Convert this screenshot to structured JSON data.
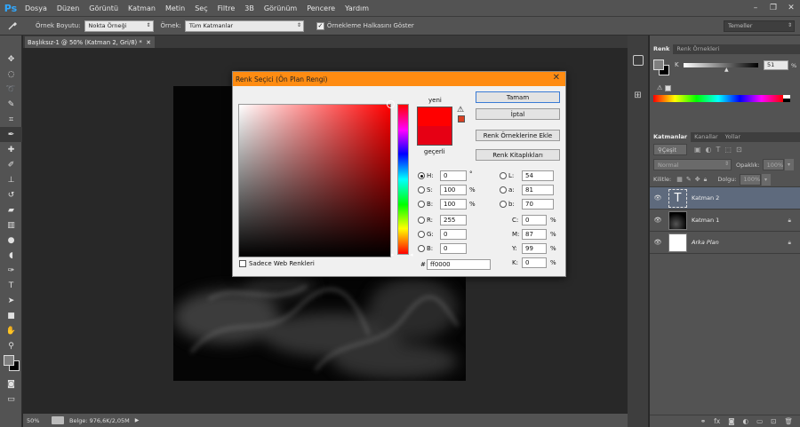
{
  "app": {
    "logo": "Ps"
  },
  "menu": [
    "Dosya",
    "Düzen",
    "Görüntü",
    "Katman",
    "Metin",
    "Seç",
    "Filtre",
    "3B",
    "Görünüm",
    "Pencere",
    "Yardım"
  ],
  "options": {
    "sample_size_label": "Örnek Boyutu:",
    "sample_size_value": "Nokta Örneği",
    "sample_label": "Örnek:",
    "sample_value": "Tüm Katmanlar",
    "show_ring_label": "Örnekleme Halkasını Göster",
    "workspace": "Temeller"
  },
  "document": {
    "tab_title": "Başlıksız-1 @ 50% (Katman 2, Gri/8) *",
    "zoom": "50%",
    "doc_size": "Belge: 976,6K/2,05M"
  },
  "color_panel": {
    "tab_color": "Renk",
    "tab_swatches": "Renk Örnekleri",
    "k_label": "K",
    "k_value": "51",
    "k_unit": "%"
  },
  "layers_panel": {
    "tabs": [
      "Katmanlar",
      "Kanallar",
      "Yollar"
    ],
    "kind_label": "Çeşit",
    "blend_mode": "Normal",
    "opacity_label": "Opaklık:",
    "opacity_value": "100%",
    "lock_label": "Kilitle:",
    "fill_label": "Dolgu:",
    "fill_value": "100%",
    "layers": [
      {
        "name": "Katman 2",
        "type": "text",
        "selected": true
      },
      {
        "name": "Katman 1",
        "type": "smoke",
        "locked": true
      },
      {
        "name": "Arka Plan",
        "type": "white",
        "locked": true
      }
    ]
  },
  "color_picker": {
    "title": "Renk Seçici (Ön Plan Rengi)",
    "new_label": "yeni",
    "current_label": "geçerli",
    "new_color": "#ff0000",
    "current_color": "#e60014",
    "ok": "Tamam",
    "cancel": "İptal",
    "add_swatches": "Renk Örneklerine Ekle",
    "libraries": "Renk Kitaplıkları",
    "web_only": "Sadece Web Renkleri",
    "h": {
      "label": "H:",
      "value": "0",
      "unit": "°"
    },
    "s": {
      "label": "S:",
      "value": "100",
      "unit": "%"
    },
    "b": {
      "label": "B:",
      "value": "100",
      "unit": "%"
    },
    "r": {
      "label": "R:",
      "value": "255"
    },
    "g": {
      "label": "G:",
      "value": "0"
    },
    "bb": {
      "label": "B:",
      "value": "0"
    },
    "l": {
      "label": "L:",
      "value": "54"
    },
    "a": {
      "label": "a:",
      "value": "81"
    },
    "lb": {
      "label": "b:",
      "value": "70"
    },
    "c": {
      "label": "C:",
      "value": "0",
      "unit": "%"
    },
    "m": {
      "label": "M:",
      "value": "87",
      "unit": "%"
    },
    "y": {
      "label": "Y:",
      "value": "99",
      "unit": "%"
    },
    "k": {
      "label": "K:",
      "value": "0",
      "unit": "%"
    },
    "hex_label": "#",
    "hex_value": "ff0000"
  }
}
